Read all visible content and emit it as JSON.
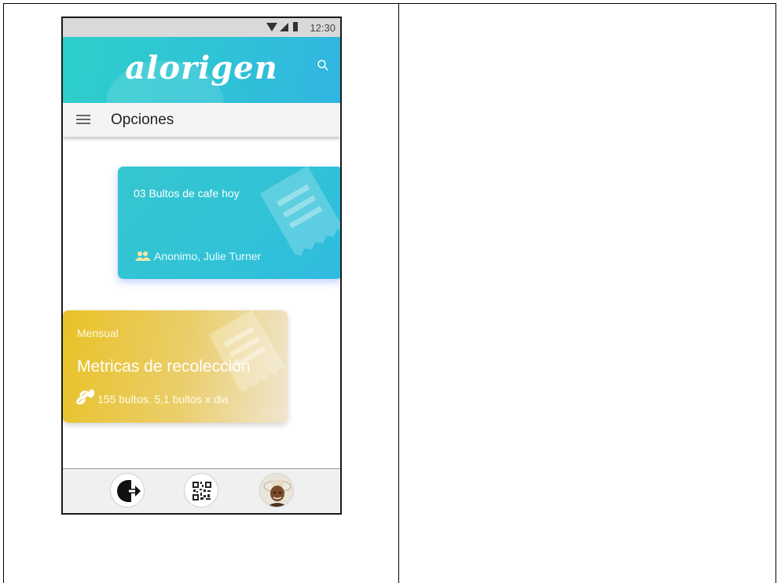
{
  "status_bar": {
    "time": "12:30"
  },
  "header": {
    "logo_text": "alorigen",
    "search_icon": "search-icon"
  },
  "options_bar": {
    "menu_icon": "hamburger-menu-icon",
    "title": "Opciones"
  },
  "cards": {
    "daily": {
      "title": "03 Bultos de cafe hoy",
      "people": "Anonimo, Julie Turner",
      "icon": "people-icon",
      "color": "#33c4d4"
    },
    "monthly": {
      "period": "Mensual",
      "heading": "Metricas de recolección",
      "stats": "155 bultos. 5,1 bultos x dia",
      "icon": "coffee-beans-icon",
      "color": "#e8c227"
    }
  },
  "bottom_nav": {
    "items": [
      {
        "icon": "logout-icon"
      },
      {
        "icon": "qr-code-icon"
      },
      {
        "icon": "profile-avatar"
      }
    ]
  }
}
